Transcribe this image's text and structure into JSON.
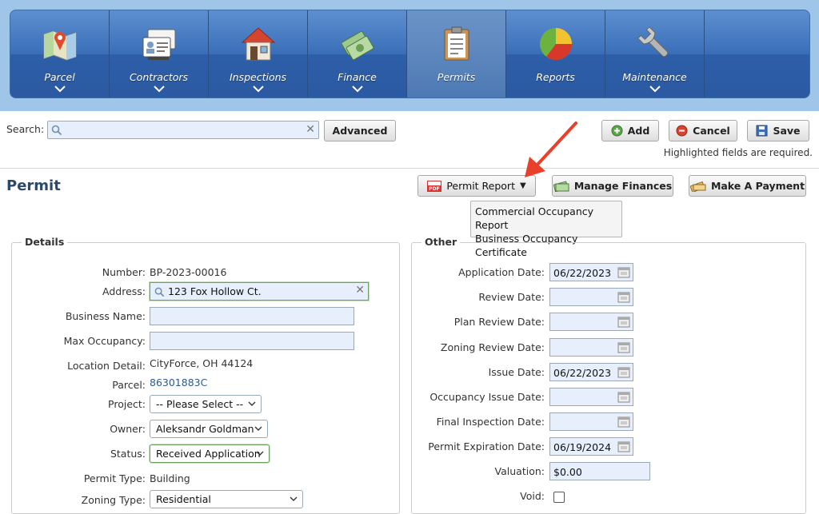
{
  "nav": {
    "items": [
      {
        "label": "Parcel"
      },
      {
        "label": "Contractors"
      },
      {
        "label": "Inspections"
      },
      {
        "label": "Finance"
      },
      {
        "label": "Permits"
      },
      {
        "label": "Reports"
      },
      {
        "label": "Maintenance"
      }
    ],
    "active": "Permits"
  },
  "toolbar": {
    "search_label": "Search:",
    "search_value": "",
    "advanced_label": "Advanced",
    "add_label": "Add",
    "cancel_label": "Cancel",
    "save_label": "Save",
    "required_hint": "Highlighted fields are required."
  },
  "page": {
    "title": "Permit",
    "permit_report_label": "Permit Report",
    "manage_finances_label": "Manage Finances",
    "make_payment_label": "Make A Payment",
    "report_menu": [
      "Commercial Occupancy Report",
      "Business Occupancy Certificate"
    ]
  },
  "details": {
    "legend": "Details",
    "number_label": "Number:",
    "number_value": "BP-2023-00016",
    "address_label": "Address:",
    "address_value": "123 Fox Hollow Ct.",
    "business_name_label": "Business Name:",
    "business_name_value": "",
    "max_occupancy_label": "Max Occupancy:",
    "max_occupancy_value": "",
    "location_label": "Location Detail:",
    "location_value": "CityForce, OH 44124",
    "parcel_label": "Parcel:",
    "parcel_value": "86301883C",
    "project_label": "Project:",
    "project_value": "-- Please Select --",
    "owner_label": "Owner:",
    "owner_value": "Aleksandr Goldman",
    "status_label": "Status:",
    "status_value": "Received Application",
    "permit_type_label": "Permit Type:",
    "permit_type_value": "Building",
    "zoning_type_label": "Zoning Type:",
    "zoning_type_value": "Residential"
  },
  "other": {
    "legend": "Other",
    "application_date_label": "Application Date:",
    "application_date_value": "06/22/2023",
    "review_date_label": "Review Date:",
    "review_date_value": "",
    "plan_review_label": "Plan Review Date:",
    "plan_review_value": "",
    "zoning_review_label": "Zoning Review Date:",
    "zoning_review_value": "",
    "issue_date_label": "Issue Date:",
    "issue_date_value": "06/22/2023",
    "occupancy_issue_label": "Occupancy Issue Date:",
    "occupancy_issue_value": "",
    "final_inspection_label": "Final Inspection Date:",
    "final_inspection_value": "",
    "expiration_label": "Permit Expiration Date:",
    "expiration_value": "06/19/2024",
    "valuation_label": "Valuation:",
    "valuation_value": "$0.00",
    "void_label": "Void:",
    "void_checked": false
  },
  "colors": {
    "nav_blue": "#2d5ea8",
    "required_border": "#6ca05e",
    "title": "#2b4a6b",
    "annotation_arrow": "#e8402a"
  }
}
